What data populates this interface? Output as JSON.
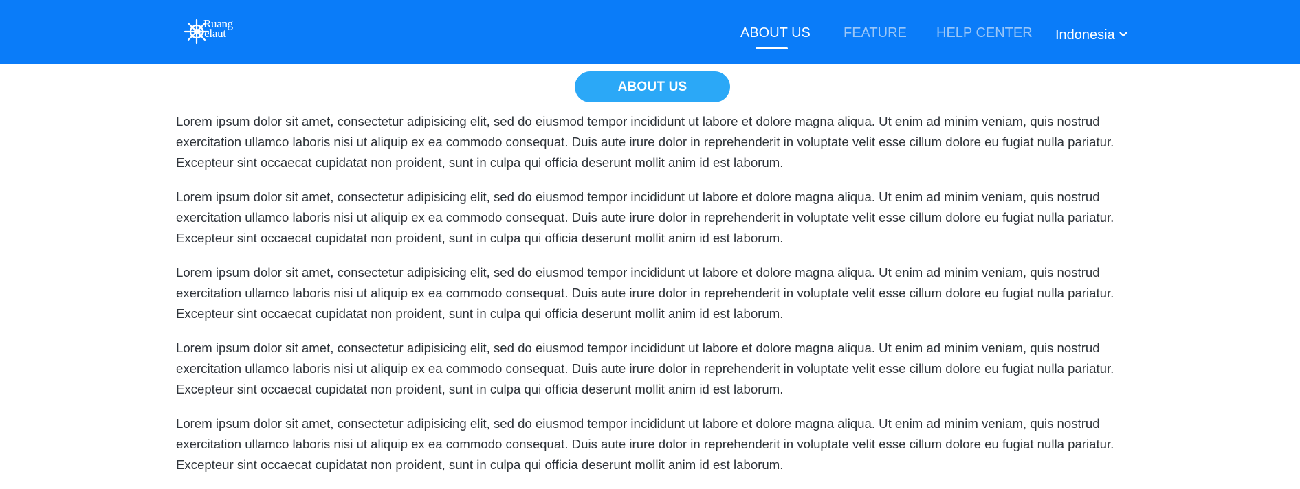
{
  "header": {
    "logo": {
      "line1": "Ruang",
      "line2": "Pelaut",
      "icon": "ship-wheel-icon"
    },
    "nav": [
      {
        "label": "ABOUT US",
        "active": true
      },
      {
        "label": "FEATURE",
        "active": false
      },
      {
        "label": "HELP CENTER",
        "active": false
      }
    ],
    "language": {
      "selected": "Indonesia",
      "icon": "chevron-down-icon"
    }
  },
  "main": {
    "section_title": "ABOUT US",
    "paragraphs": [
      "Lorem ipsum dolor sit amet, consectetur adipisicing elit, sed do eiusmod tempor incididunt ut labore et dolore magna aliqua. Ut enim ad minim veniam, quis nostrud exercitation ullamco laboris nisi ut aliquip ex ea commodo consequat. Duis aute irure dolor in reprehenderit in voluptate velit esse cillum dolore eu fugiat nulla pariatur. Excepteur sint occaecat cupidatat non proident, sunt in culpa qui officia deserunt mollit anim id est laborum.",
      "Lorem ipsum dolor sit amet, consectetur adipisicing elit, sed do eiusmod tempor incididunt ut labore et dolore magna aliqua. Ut enim ad minim veniam, quis nostrud exercitation ullamco laboris nisi ut aliquip ex ea commodo consequat. Duis aute irure dolor in reprehenderit in voluptate velit esse cillum dolore eu fugiat nulla pariatur. Excepteur sint occaecat cupidatat non proident, sunt in culpa qui officia deserunt mollit anim id est laborum.",
      "Lorem ipsum dolor sit amet, consectetur adipisicing elit, sed do eiusmod tempor incididunt ut labore et dolore magna aliqua. Ut enim ad minim veniam, quis nostrud exercitation ullamco laboris nisi ut aliquip ex ea commodo consequat. Duis aute irure dolor in reprehenderit in voluptate velit esse cillum dolore eu fugiat nulla pariatur. Excepteur sint occaecat cupidatat non proident, sunt in culpa qui officia deserunt mollit anim id est laborum.",
      "Lorem ipsum dolor sit amet, consectetur adipisicing elit, sed do eiusmod tempor incididunt ut labore et dolore magna aliqua. Ut enim ad minim veniam, quis nostrud exercitation ullamco laboris nisi ut aliquip ex ea commodo consequat. Duis aute irure dolor in reprehenderit in voluptate velit esse cillum dolore eu fugiat nulla pariatur. Excepteur sint occaecat cupidatat non proident, sunt in culpa qui officia deserunt mollit anim id est laborum.",
      "Lorem ipsum dolor sit amet, consectetur adipisicing elit, sed do eiusmod tempor incididunt ut labore et dolore magna aliqua. Ut enim ad minim veniam, quis nostrud exercitation ullamco laboris nisi ut aliquip ex ea commodo consequat. Duis aute irure dolor in reprehenderit in voluptate velit esse cillum dolore eu fugiat nulla pariatur. Excepteur sint occaecat cupidatat non proident, sunt in culpa qui officia deserunt mollit anim id est laborum."
    ]
  },
  "colors": {
    "header_bg": "#0a7cf9",
    "nav_inactive": "#9cc7f7",
    "nav_active": "#ffffff",
    "pill_bg": "#2ba8f7",
    "body_text": "#2f343a"
  }
}
